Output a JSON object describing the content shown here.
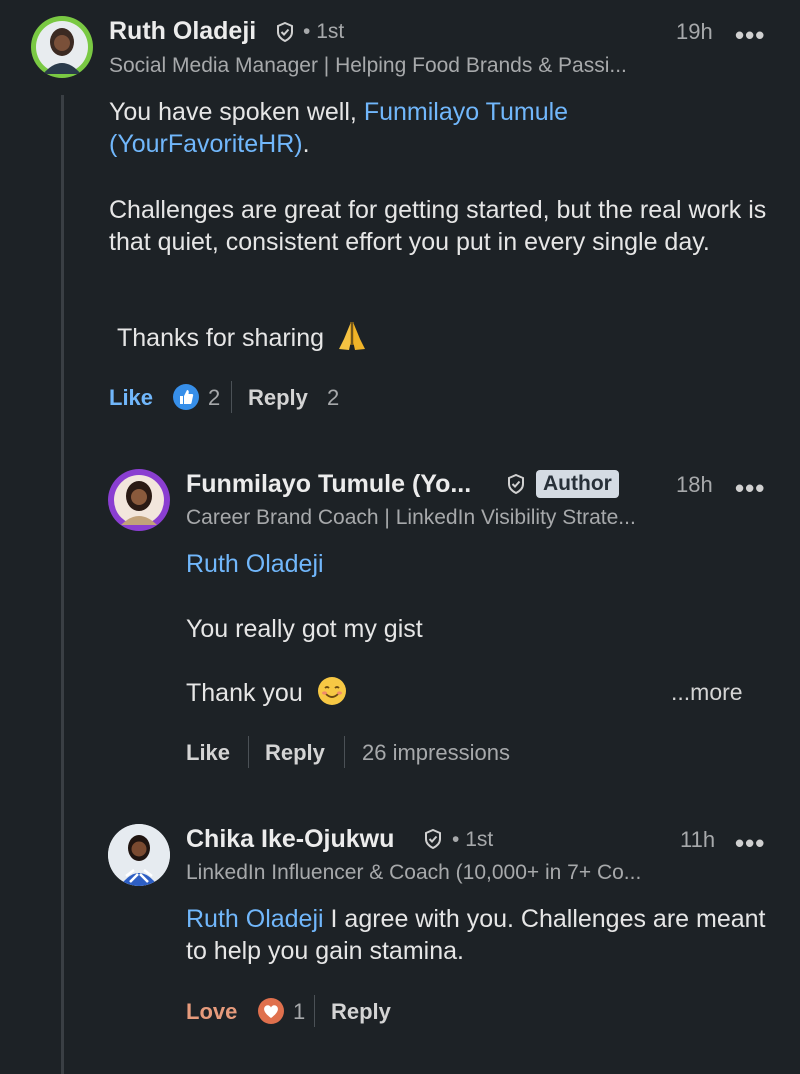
{
  "colors": {
    "background": "#1d2226",
    "link": "#71b7fb",
    "like_blue": "#378fe9",
    "love_orange": "#e69b7c",
    "muted": "#a7a9ab"
  },
  "comments": [
    {
      "name": "Ruth Oladeji",
      "degree": "1st",
      "time": "19h",
      "headline": "Social Media Manager | Helping Food Brands & Passi...",
      "mention": "Funmilayo Tumule (YourFavoriteHR)",
      "text_before_mention": "You have spoken well, ",
      "text_after_mention": ".",
      "paragraph2": "Challenges are great for getting started, but the real work is that quiet, consistent effort you put in every single day.",
      "paragraph3": "Thanks for sharing",
      "like_label": "Like",
      "reaction_count": "2",
      "reply_label": "Reply",
      "reply_count": "2",
      "reaction_icon": "thumbs-up-icon",
      "emoji_icon": "folded-hands-icon"
    },
    {
      "name": "Funmilayo Tumule (Yo...",
      "badge": "Author",
      "time": "18h",
      "headline": "Career Brand Coach | LinkedIn Visibility Strate...",
      "mention": "Ruth Oladeji",
      "paragraph2": "You really got my gist",
      "paragraph3": "Thank you",
      "more_label": "...more",
      "like_label": "Like",
      "reply_label": "Reply",
      "impressions": "26 impressions",
      "emoji_icon": "smiling-face-icon"
    },
    {
      "name": "Chika Ike-Ojukwu",
      "degree": "1st",
      "time": "11h",
      "headline": "LinkedIn Influencer & Coach (10,000+ in 7+ Co...",
      "mention": "Ruth Oladeji",
      "text_after_mention": " I agree with you. Challenges are meant to help you gain stamina.",
      "like_label": "Love",
      "reaction_count": "1",
      "reply_label": "Reply",
      "reaction_icon": "heart-icon"
    }
  ]
}
